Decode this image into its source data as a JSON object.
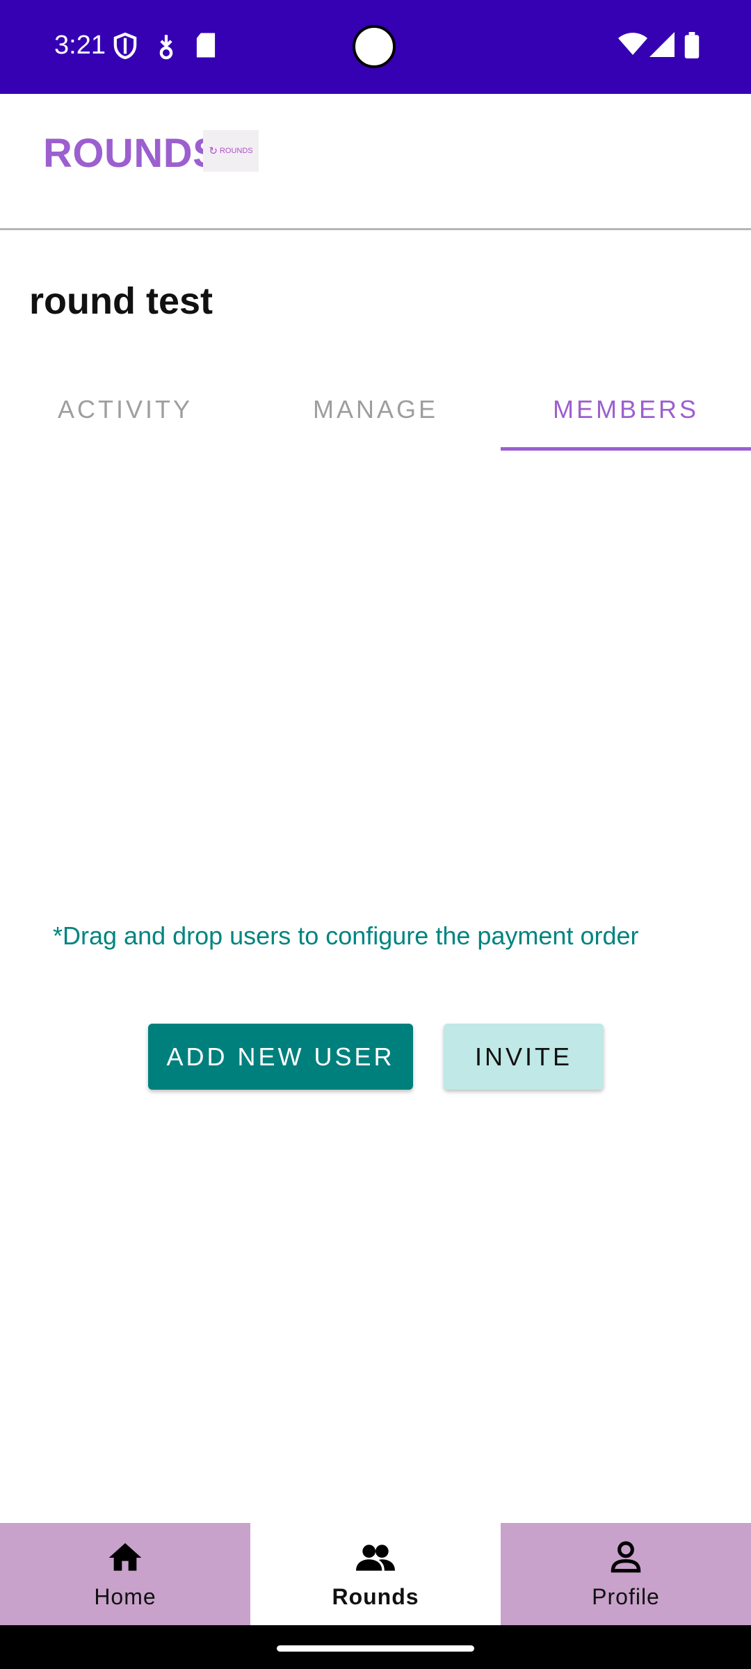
{
  "status_bar": {
    "time": "3:21",
    "icons_left": [
      "shield-icon",
      "download-icon",
      "sd-card-icon"
    ],
    "icons_right": [
      "wifi-icon",
      "signal-icon",
      "battery-icon"
    ]
  },
  "app_bar": {
    "brand": "ROUNDS",
    "logo_text": "ROUNDS"
  },
  "page": {
    "title": "round test"
  },
  "tabs": [
    {
      "label": "ACTIVITY",
      "active": false
    },
    {
      "label": "MANAGE",
      "active": false
    },
    {
      "label": "MEMBERS",
      "active": true
    }
  ],
  "members": {
    "hint": "*Drag and drop users to configure the payment order",
    "add_button": "ADD NEW USER",
    "invite_button": "INVITE"
  },
  "bottom_nav": [
    {
      "label": "Home",
      "icon": "home-icon",
      "active": false
    },
    {
      "label": "Rounds",
      "icon": "group-icon",
      "active": true
    },
    {
      "label": "Profile",
      "icon": "person-icon",
      "active": false
    }
  ],
  "colors": {
    "status_bar": "#3600b3",
    "accent": "#9c5fcf",
    "teal": "#00807d",
    "teal_light": "#bfe8e6",
    "nav_bg": "#c8a2cb"
  }
}
